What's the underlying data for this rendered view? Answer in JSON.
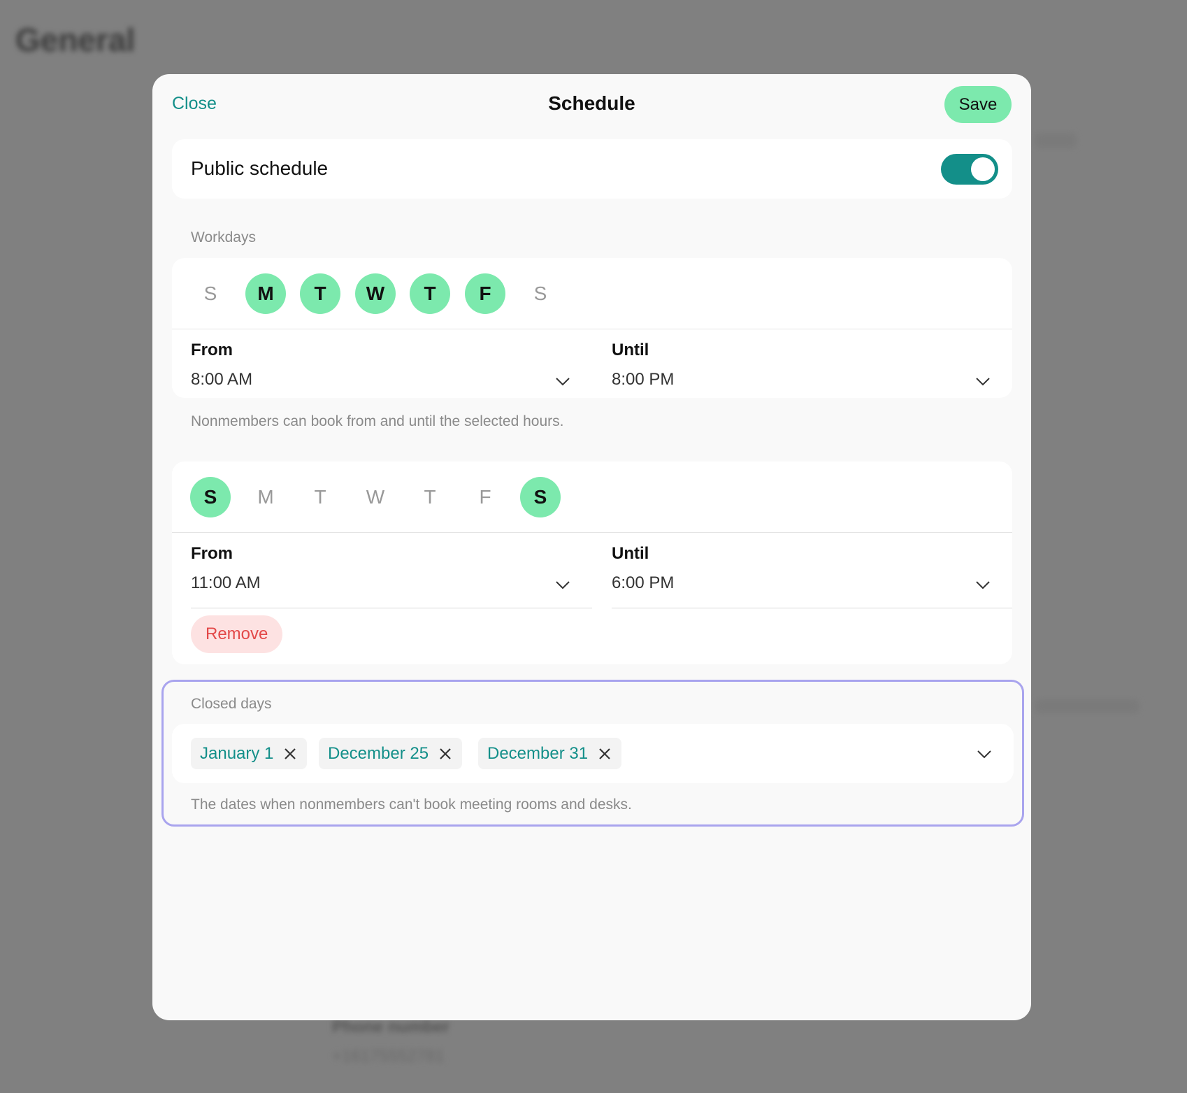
{
  "background": {
    "page_title": "General",
    "field_label": "Phone number",
    "field_value": "+16175552781"
  },
  "modal": {
    "close_label": "Close",
    "title": "Schedule",
    "save_label": "Save"
  },
  "public_schedule": {
    "label": "Public schedule",
    "enabled": true
  },
  "workdays": {
    "section_label": "Workdays",
    "days": [
      {
        "letter": "S",
        "selected": false
      },
      {
        "letter": "M",
        "selected": true
      },
      {
        "letter": "T",
        "selected": true
      },
      {
        "letter": "W",
        "selected": true
      },
      {
        "letter": "T",
        "selected": true
      },
      {
        "letter": "F",
        "selected": true
      },
      {
        "letter": "S",
        "selected": false
      }
    ],
    "from_label": "From",
    "from_value": "8:00 AM",
    "until_label": "Until",
    "until_value": "8:00 PM",
    "helper": "Nonmembers can book from and until the selected hours."
  },
  "weekend": {
    "days": [
      {
        "letter": "S",
        "selected": true
      },
      {
        "letter": "M",
        "selected": false
      },
      {
        "letter": "T",
        "selected": false
      },
      {
        "letter": "W",
        "selected": false
      },
      {
        "letter": "T",
        "selected": false
      },
      {
        "letter": "F",
        "selected": false
      },
      {
        "letter": "S",
        "selected": true
      }
    ],
    "from_label": "From",
    "from_value": "11:00 AM",
    "until_label": "Until",
    "until_value": "6:00 PM",
    "remove_label": "Remove"
  },
  "closed_days": {
    "section_label": "Closed days",
    "tags": [
      "January 1",
      "December 25",
      "December 31"
    ],
    "helper": "The dates when nonmembers can't book meeting rooms and desks."
  },
  "colors": {
    "accent": "#138f89",
    "day_selected": "#7ce9ad",
    "remove_bg": "#fde2e2",
    "remove_text": "#e34848",
    "focus_frame": "#a9a4ee"
  }
}
